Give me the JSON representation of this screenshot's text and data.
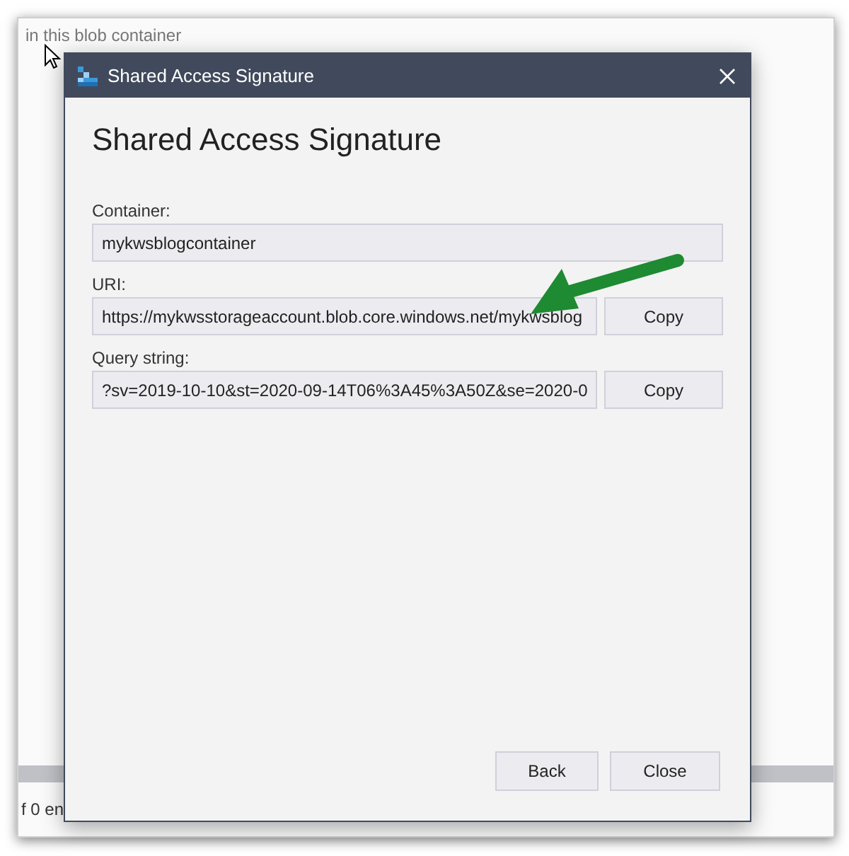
{
  "background": {
    "hint": "in this blob container",
    "footer": "f 0 en"
  },
  "dialog": {
    "title": "Shared Access Signature",
    "heading": "Shared Access Signature",
    "fields": [
      {
        "label": "Container:",
        "value": "mykwsblogcontainer"
      },
      {
        "label": "URI:",
        "value": "https://mykwsstorageaccount.blob.core.windows.net/mykwsblog",
        "action": "Copy"
      },
      {
        "label": "Query string:",
        "value": "?sv=2019-10-10&st=2020-09-14T06%3A45%3A50Z&se=2020-0",
        "action": "Copy"
      }
    ],
    "buttons": [
      "Back",
      "Close"
    ]
  }
}
